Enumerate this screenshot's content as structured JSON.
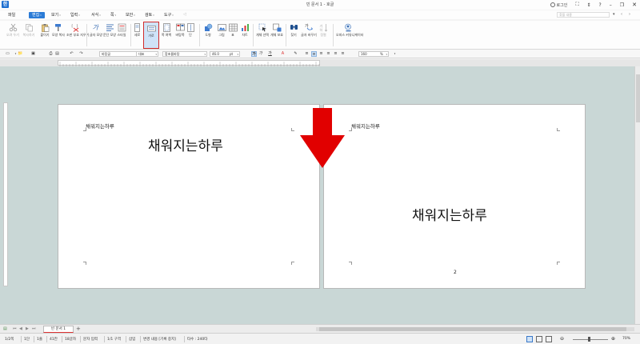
{
  "window": {
    "title": "빈 문서 1 - 호글",
    "login_label": "로그인",
    "app_logo": "한"
  },
  "menu": {
    "items": [
      {
        "label": "파일",
        "has_dropdown": false
      },
      {
        "label": "편집",
        "has_dropdown": true,
        "active": true
      },
      {
        "label": "보기",
        "has_dropdown": true
      },
      {
        "label": "입력",
        "has_dropdown": true
      },
      {
        "label": "서식",
        "has_dropdown": true
      },
      {
        "label": "쪽",
        "has_dropdown": true
      },
      {
        "label": "보안",
        "has_dropdown": true
      },
      {
        "label": "검토",
        "has_dropdown": true
      },
      {
        "label": "도구",
        "has_dropdown": true
      }
    ],
    "search_placeholder": "찾을 내용"
  },
  "ribbon": {
    "buttons": [
      {
        "label": "오려 두기",
        "icon": "scissors-icon",
        "disabled": true
      },
      {
        "label": "복사하기",
        "icon": "copy-icon",
        "disabled": true
      },
      {
        "label": "붙이기",
        "icon": "paste-icon"
      },
      {
        "label": "모양 복사",
        "icon": "format-painter-icon"
      },
      {
        "label": "조판 부호 지우기",
        "icon": "clear-code-icon"
      },
      {
        "label": "글자 모양",
        "icon": "char-shape-icon"
      },
      {
        "label": "문단 모양",
        "icon": "para-shape-icon"
      },
      {
        "label": "스타일",
        "icon": "style-icon"
      },
      {
        "label": "세로",
        "icon": "portrait-icon"
      },
      {
        "label": "가로",
        "icon": "landscape-icon",
        "highlighted": true
      },
      {
        "label": "쪽 여백",
        "icon": "margin-icon"
      },
      {
        "label": "바탕쪽",
        "icon": "master-page-icon"
      },
      {
        "label": "단",
        "icon": "column-icon"
      },
      {
        "label": "도형",
        "icon": "shape-icon"
      },
      {
        "label": "그림",
        "icon": "picture-icon"
      },
      {
        "label": "표",
        "icon": "table-icon"
      },
      {
        "label": "차트",
        "icon": "chart-icon"
      },
      {
        "label": "개체 선택",
        "icon": "object-select-icon"
      },
      {
        "label": "개체 보호",
        "icon": "object-protect-icon"
      },
      {
        "label": "찾기",
        "icon": "find-icon"
      },
      {
        "label": "글자 바꾸기",
        "icon": "replace-icon"
      },
      {
        "label": "정렬",
        "icon": "sort-icon",
        "disabled": true
      },
      {
        "label": "오피스 커뮤니케이터",
        "icon": "communicator-icon"
      }
    ]
  },
  "format_bar": {
    "style": "바탕글",
    "lang": "대표",
    "font": "함초롬바탕",
    "font_size": "46.0",
    "unit": "pt",
    "zoom": "160",
    "zoom_unit": "%",
    "bold": "가",
    "italic": "가",
    "underline": "가"
  },
  "pages": [
    {
      "header": "채워지는하루",
      "body": "채워지는하루"
    },
    {
      "header": "채워지는하루",
      "body": "채워지는하루",
      "page_number": "2"
    }
  ],
  "tabs": {
    "doc_tab": "빈 문서 1",
    "add": "+"
  },
  "status": {
    "page": "1/2쪽",
    "column": "1단",
    "line": "1줄",
    "cell": "41칸",
    "chars": "18글자",
    "mode": "문자 입력",
    "section": "1/1 구역",
    "insert": "삽입",
    "track": "변경 내용 [기록 중지]",
    "typing": "타수 : 240타",
    "zoom": "70%"
  },
  "colors": {
    "accent": "#2b7bd6",
    "highlight_border": "#d02b2b",
    "arrow": "#e10000",
    "workspace": "#c9d7d6"
  }
}
